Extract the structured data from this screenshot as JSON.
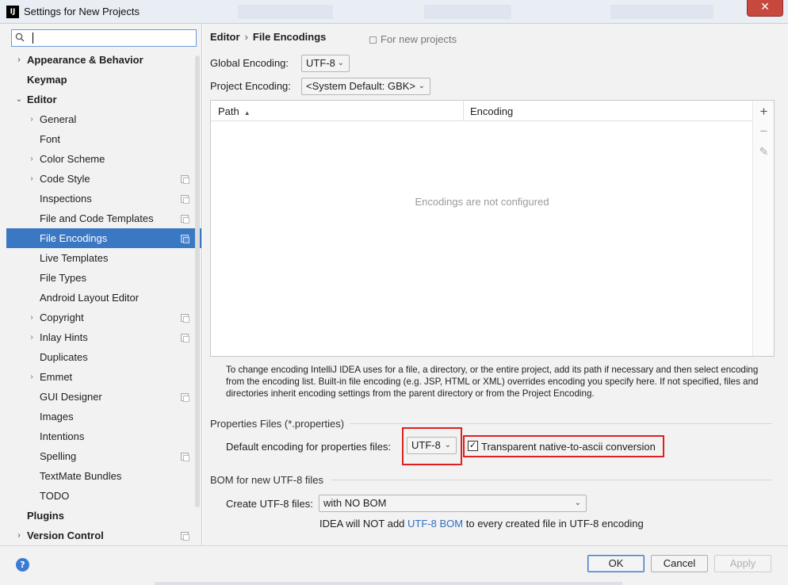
{
  "window": {
    "title": "Settings for New Projects",
    "app_icon": "IJ",
    "close_glyph": "✕"
  },
  "sidebar": {
    "search": {
      "placeholder": "",
      "value": ""
    },
    "items": [
      {
        "label": "Appearance & Behavior",
        "level": 0,
        "arrow": "›",
        "copy": false
      },
      {
        "label": "Keymap",
        "level": 0,
        "arrow": "",
        "copy": false
      },
      {
        "label": "Editor",
        "level": 0,
        "arrow": "⌄",
        "copy": false
      },
      {
        "label": "General",
        "level": 1,
        "arrow": "›",
        "copy": false
      },
      {
        "label": "Font",
        "level": 1,
        "arrow": "",
        "copy": false
      },
      {
        "label": "Color Scheme",
        "level": 1,
        "arrow": "›",
        "copy": false
      },
      {
        "label": "Code Style",
        "level": 1,
        "arrow": "›",
        "copy": true
      },
      {
        "label": "Inspections",
        "level": 1,
        "arrow": "",
        "copy": true
      },
      {
        "label": "File and Code Templates",
        "level": 1,
        "arrow": "",
        "copy": true
      },
      {
        "label": "File Encodings",
        "level": 1,
        "arrow": "",
        "copy": true,
        "selected": true
      },
      {
        "label": "Live Templates",
        "level": 1,
        "arrow": "",
        "copy": false
      },
      {
        "label": "File Types",
        "level": 1,
        "arrow": "",
        "copy": false
      },
      {
        "label": "Android Layout Editor",
        "level": 1,
        "arrow": "",
        "copy": false
      },
      {
        "label": "Copyright",
        "level": 1,
        "arrow": "›",
        "copy": true
      },
      {
        "label": "Inlay Hints",
        "level": 1,
        "arrow": "›",
        "copy": true
      },
      {
        "label": "Duplicates",
        "level": 1,
        "arrow": "",
        "copy": false
      },
      {
        "label": "Emmet",
        "level": 1,
        "arrow": "›",
        "copy": false
      },
      {
        "label": "GUI Designer",
        "level": 1,
        "arrow": "",
        "copy": true
      },
      {
        "label": "Images",
        "level": 1,
        "arrow": "",
        "copy": false
      },
      {
        "label": "Intentions",
        "level": 1,
        "arrow": "",
        "copy": false
      },
      {
        "label": "Spelling",
        "level": 1,
        "arrow": "",
        "copy": true
      },
      {
        "label": "TextMate Bundles",
        "level": 1,
        "arrow": "",
        "copy": false
      },
      {
        "label": "TODO",
        "level": 1,
        "arrow": "",
        "copy": false
      },
      {
        "label": "Plugins",
        "level": 0,
        "arrow": "",
        "copy": false
      },
      {
        "label": "Version Control",
        "level": 0,
        "arrow": "›",
        "copy": true
      }
    ]
  },
  "main": {
    "breadcrumb": {
      "parent": "Editor",
      "separator": "›",
      "current": "File Encodings"
    },
    "for_new_projects": "For new projects",
    "global_encoding": {
      "label": "Global Encoding:",
      "value": "UTF-8"
    },
    "project_encoding": {
      "label": "Project Encoding:",
      "value": "<System Default: GBK>"
    },
    "table": {
      "columns": [
        "Path",
        "Encoding"
      ],
      "sort_glyph": "▲",
      "empty_text": "Encodings are not configured",
      "tools": {
        "add": "+",
        "remove": "−",
        "edit": "✎"
      }
    },
    "help_text": "To change encoding IntelliJ IDEA uses for a file, a directory, or the entire project, add its path if necessary and then select encoding from the encoding list. Built-in file encoding (e.g. JSP, HTML or XML) overrides encoding you specify here. If not specified, files and directories inherit encoding settings from the parent directory or from the Project Encoding.",
    "properties": {
      "title": "Properties Files (*.properties)",
      "default_label": "Default encoding for properties files:",
      "default_value": "UTF-8",
      "transparent_label": "Transparent native-to-ascii conversion",
      "transparent_checked": true
    },
    "bom": {
      "title": "BOM for new UTF-8 files",
      "create_label": "Create UTF-8 files:",
      "create_value": "with NO BOM",
      "note_prefix": "IDEA will NOT add",
      "note_link": "UTF-8 BOM",
      "note_suffix": "to every created file in UTF-8 encoding"
    }
  },
  "footer": {
    "help": "?",
    "ok": "OK",
    "cancel": "Cancel",
    "apply": "Apply"
  },
  "colors": {
    "selection": "#3b78c3",
    "highlight_box": "#e02020",
    "link": "#2f6fbf"
  }
}
